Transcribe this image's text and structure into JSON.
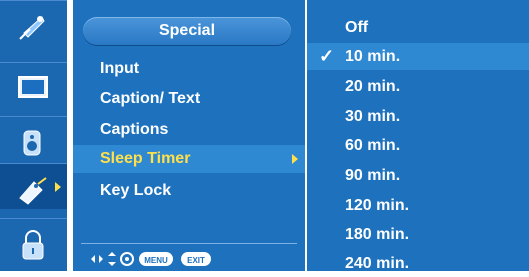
{
  "menu": {
    "title": "Special",
    "items": [
      {
        "label": "Input"
      },
      {
        "label": "Caption/ Text"
      },
      {
        "label": "Captions"
      },
      {
        "label": "Sleep Timer",
        "active": true
      },
      {
        "label": "Key Lock"
      }
    ],
    "help": {
      "menu_key": "MENU",
      "exit_key": "EXIT"
    }
  },
  "options": {
    "items": [
      "Off",
      "10 min.",
      "20 min.",
      "30 min.",
      "60 min.",
      "90 min.",
      "120 min.",
      "180 min.",
      "240 min."
    ],
    "selected": "10 min.",
    "check_glyph": "✓"
  },
  "icons": [
    "satellite-icon",
    "screen-icon",
    "speaker-icon",
    "special-tag-icon",
    "lock-icon"
  ],
  "colors": {
    "panel": "#1d71bd",
    "highlight": "#2f88d2",
    "accent": "#ffe04a"
  }
}
